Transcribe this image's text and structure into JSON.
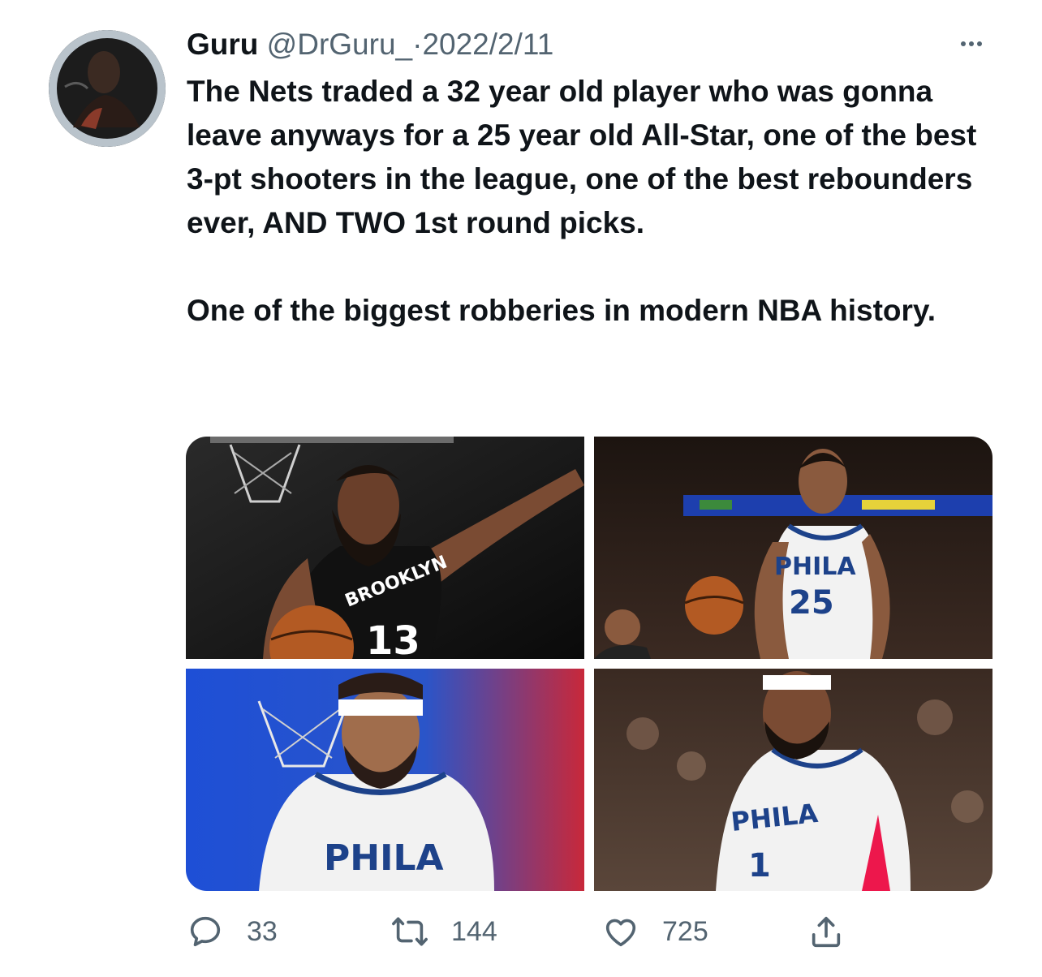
{
  "tweet": {
    "author_name": "Guru",
    "handle": "@DrGuru_",
    "separator": "·",
    "date": "2022/2/11",
    "paragraph_1": "The Nets traded a 32 year old player who was gonna leave anyways for a 25 year old All-Star, one of the best 3-pt shooters in the league, one of the best rebounders ever, AND TWO 1st round picks.",
    "paragraph_2": "One of the biggest robberies in modern NBA history."
  },
  "media": {
    "photo_1": {
      "jersey_text": "BROOKLYN",
      "number": "13"
    },
    "photo_2": {
      "jersey_text": "PHILA",
      "number": "25"
    },
    "photo_3": {
      "jersey_text": "PHILA"
    },
    "photo_4": {
      "jersey_text": "PHILA",
      "number": "1"
    }
  },
  "actions": {
    "reply_count": "33",
    "retweet_count": "144",
    "like_count": "725"
  },
  "icons": {
    "more": "more-dots-icon",
    "reply": "reply-icon",
    "retweet": "retweet-icon",
    "like": "heart-icon",
    "share": "share-icon"
  },
  "colors": {
    "text": "#0f1419",
    "secondary": "#536471",
    "nets_black": "#111111",
    "sixers_blue": "#1d428a",
    "sixers_red": "#ed174c"
  }
}
